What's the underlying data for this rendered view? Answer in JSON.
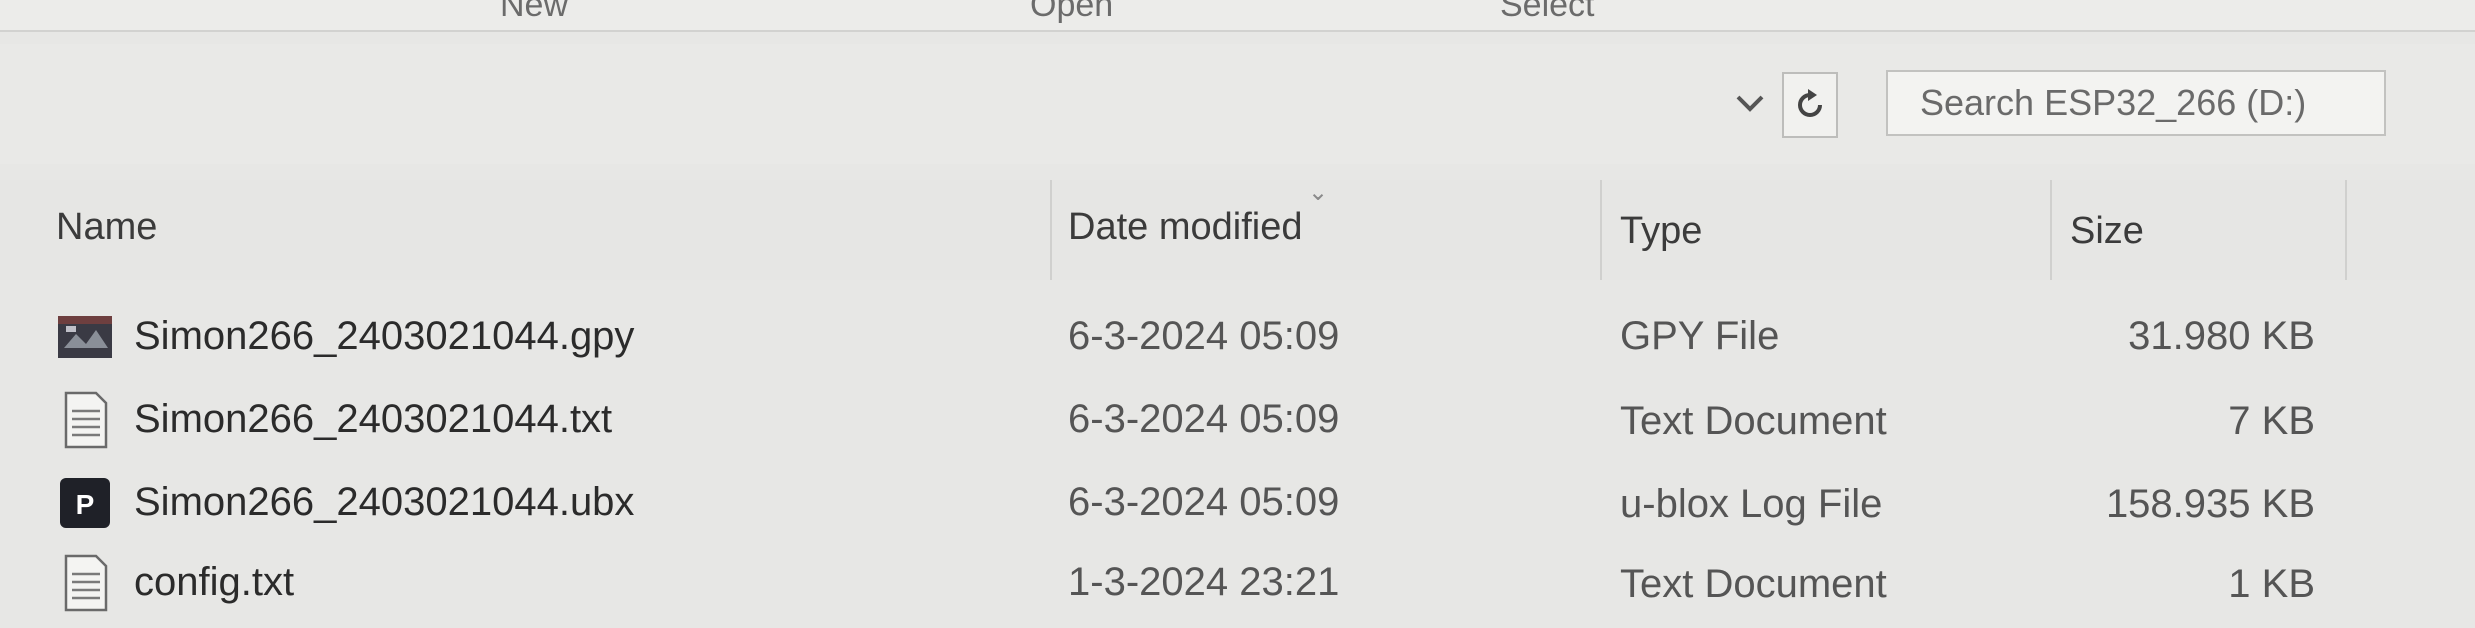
{
  "ribbon": {
    "labels": [
      "New",
      "Open",
      "Select"
    ]
  },
  "address_bar": {
    "dropdown_icon": "chevron-down-icon",
    "refresh_icon": "refresh-icon",
    "search_placeholder": "Search ESP32_266 (D:)"
  },
  "columns": {
    "name": "Name",
    "date_modified": "Date modified",
    "type": "Type",
    "size": "Size"
  },
  "files": [
    {
      "name": "Simon266_2403021044.gpy",
      "date": "6-3-2024 05:09",
      "type": "GPY File",
      "size": "31.980 KB",
      "icon": "gpy-file-icon"
    },
    {
      "name": "Simon266_2403021044.txt",
      "date": "6-3-2024 05:09",
      "type": "Text Document",
      "size": "7 KB",
      "icon": "text-file-icon"
    },
    {
      "name": "Simon266_2403021044.ubx",
      "date": "6-3-2024 05:09",
      "type": "u-blox Log File",
      "size": "158.935 KB",
      "icon": "ublox-file-icon"
    },
    {
      "name": "config.txt",
      "date": "1-3-2024 23:21",
      "type": "Text Document",
      "size": "1 KB",
      "icon": "text-file-icon"
    }
  ]
}
